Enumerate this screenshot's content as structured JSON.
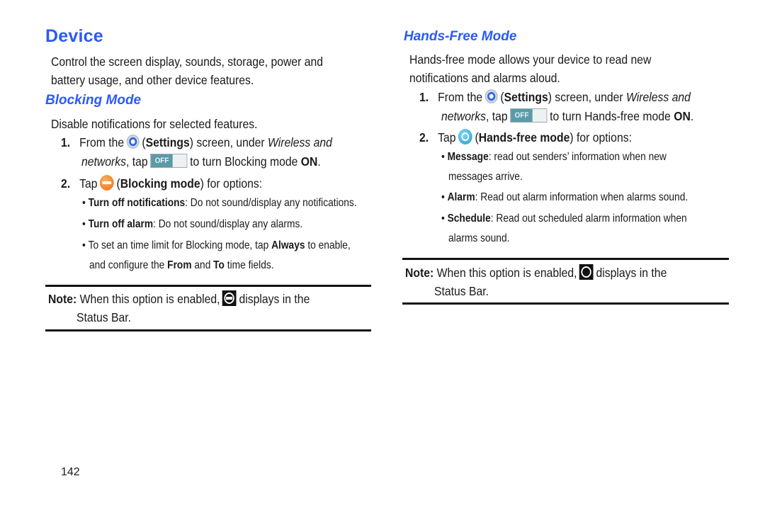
{
  "page": {
    "title": "Device",
    "intro": [
      "Control the screen display, sounds, storage, power and",
      "battery usage, and other device features."
    ],
    "page_number": "142"
  },
  "blocking": {
    "heading": "Blocking Mode",
    "description": "Disable notifications for selected features.",
    "step1": {
      "num": "1.",
      "line1_a": "From the",
      "settings_label": "Settings",
      "line1_b": "screen, under",
      "wireless": "Wireless and",
      "networks": "networks",
      "tap": ", tap",
      "toggle_label": "OFF",
      "line2_b": "to turn Blocking mode",
      "on": "ON",
      "period": "."
    },
    "step2": {
      "num": "2.",
      "tap": "Tap",
      "label": "Blocking mode",
      "rest": "for options:"
    },
    "bullets": [
      {
        "bold": "Turn off notifications",
        "text": ": Do not sound/display any notifications."
      },
      {
        "bold": "Turn off alarm",
        "text": ": Do not sound/display any alarms."
      },
      {
        "pre": "To set an time limit for Blocking mode, tap ",
        "bold": "Always",
        "text": " to enable,",
        "line2_a": "and configure the ",
        "from": "From",
        "line2_b": " and ",
        "to": "To",
        "line2_c": " time fields."
      }
    ],
    "note": {
      "label": "Note:",
      "text_a": "When this option is enabled,",
      "text_b": "displays in the",
      "line2": "Status Bar."
    }
  },
  "handsfree": {
    "heading": "Hands-Free Mode",
    "intro": [
      "Hands-free mode allows your device to read new",
      "notifications and alarms aloud."
    ],
    "step1": {
      "num": "1.",
      "line1_a": "From the",
      "settings_label": "Settings",
      "line1_b": "screen, under",
      "wireless": "Wireless and",
      "networks": "networks",
      "tap": ", tap",
      "toggle_label": "OFF",
      "line2_b": "to turn Hands-free mode",
      "on": "ON",
      "period": "."
    },
    "step2": {
      "num": "2.",
      "tap": "Tap",
      "label": "Hands-free mode",
      "rest": "for options:"
    },
    "bullets": [
      {
        "bold": "Message",
        "text": ": read out senders’ information when new",
        "line2": "messages arrive."
      },
      {
        "bold": "Alarm",
        "text": ": Read out alarm information when alarms sound."
      },
      {
        "bold": "Schedule",
        "text": ": Read out scheduled alarm information when",
        "line2": "alarms sound."
      }
    ],
    "note": {
      "label": "Note:",
      "text_a": "When this option is enabled,",
      "text_b": "displays in the",
      "line2": "Status Bar."
    }
  }
}
